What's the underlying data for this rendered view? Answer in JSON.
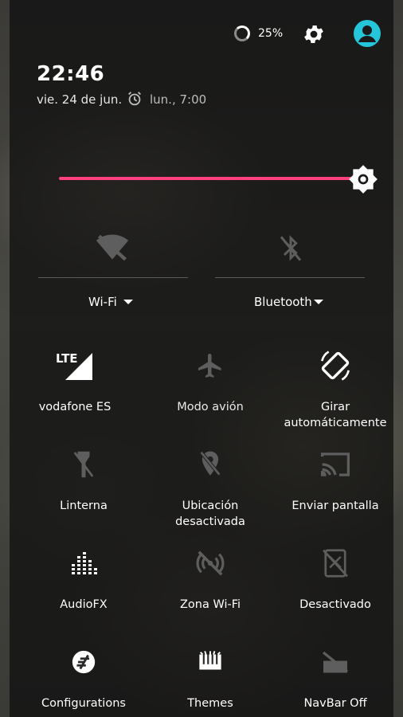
{
  "status": {
    "battery_text": "25%"
  },
  "header": {
    "time": "22:46",
    "date": "vie. 24 de jun.",
    "alarm": "lun., 7:00"
  },
  "brightness": {
    "level_percent": 92,
    "accent_color": "#ff4081"
  },
  "connections": {
    "wifi": {
      "label": "Wi-Fi",
      "icon": "wifi-off-icon"
    },
    "bluetooth": {
      "label": "Bluetooth",
      "icon": "bluetooth-off-icon"
    }
  },
  "tiles": [
    {
      "label": "vodafone ES",
      "icon": "lte-signal-icon"
    },
    {
      "label": "Modo avión",
      "icon": "airplane-icon"
    },
    {
      "label": "Girar automáticamente",
      "icon": "auto-rotate-icon"
    },
    {
      "label": "Linterna",
      "icon": "flashlight-off-icon"
    },
    {
      "label": "Ubicación desactivada",
      "icon": "location-off-icon"
    },
    {
      "label": "Enviar pantalla",
      "icon": "cast-icon"
    },
    {
      "label": "AudioFX",
      "icon": "equalizer-icon"
    },
    {
      "label": "Zona Wi-Fi",
      "icon": "hotspot-off-icon"
    },
    {
      "label": "Desactivado",
      "icon": "screen-off-icon"
    },
    {
      "label": "Configurations",
      "icon": "configurations-icon"
    },
    {
      "label": "Themes",
      "icon": "themes-icon"
    },
    {
      "label": "NavBar Off",
      "icon": "navbar-off-icon"
    }
  ],
  "lte_badge": "LTE",
  "accent_avatar": "#26c6da"
}
